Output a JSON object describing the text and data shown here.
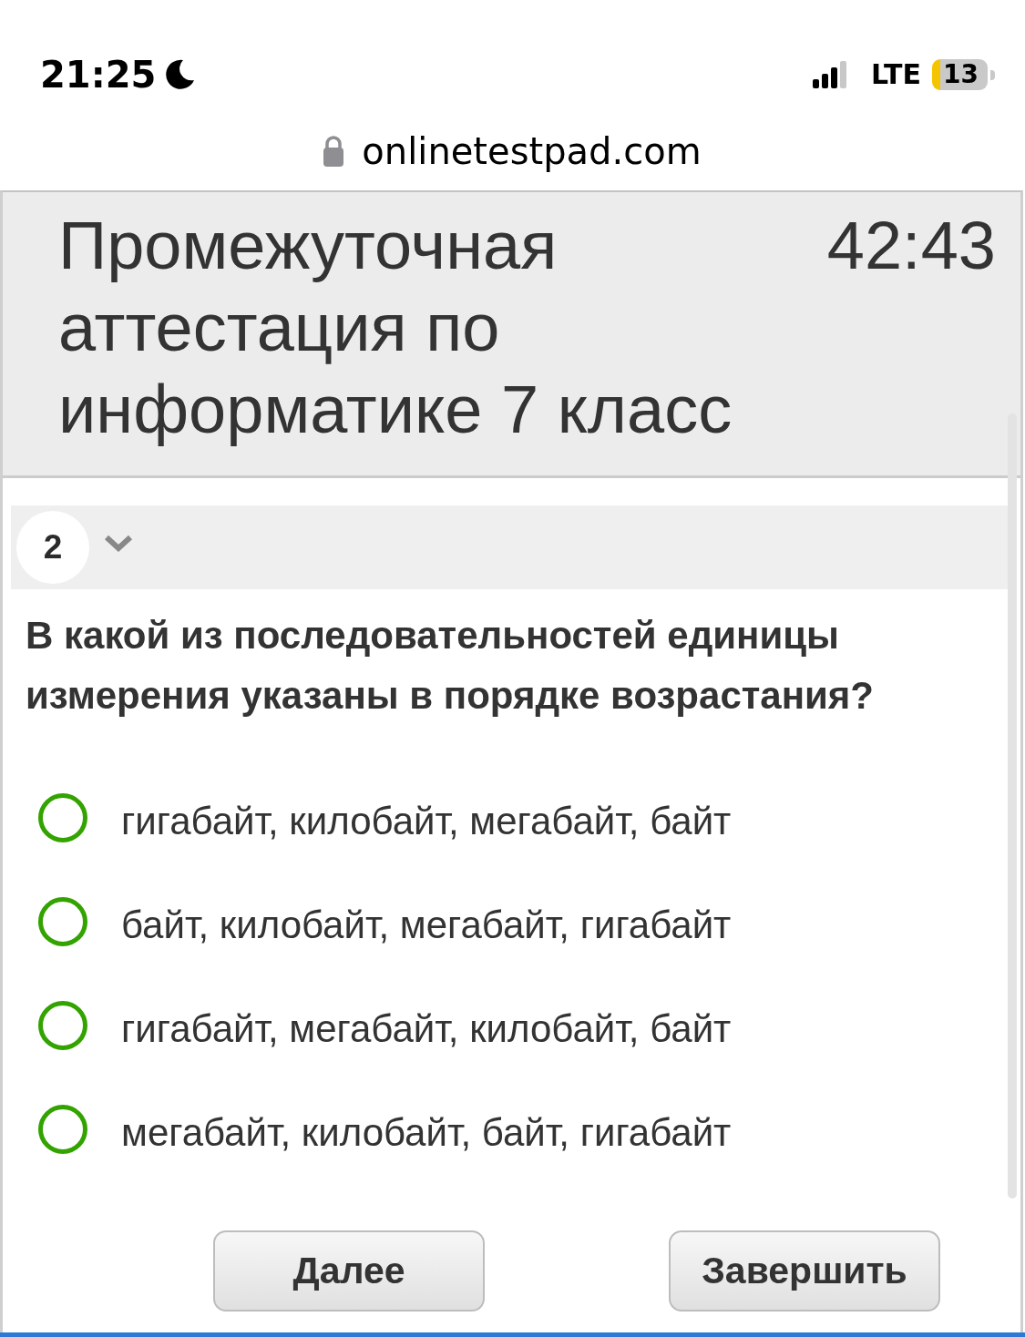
{
  "status_bar": {
    "time": "21:25",
    "network": "LTE",
    "battery": "13"
  },
  "address_bar": {
    "url": "onlinetestpad.com"
  },
  "test": {
    "title": "Промежуточная аттестация по информатике 7 класс",
    "timer": "42:43"
  },
  "question": {
    "number": "2",
    "text": "В какой из последовательностей единицы измерения указаны в порядке возрастания?",
    "options": [
      {
        "label": "гигабайт, килобайт, мегабайт, байт",
        "selected": false
      },
      {
        "label": "байт, килобайт, мегабайт, гигабайт",
        "selected": false
      },
      {
        "label": "гигабайт, мегабайт, килобайт, байт",
        "selected": false
      },
      {
        "label": "мегабайт, килобайт, байт, гигабайт",
        "selected": false
      }
    ]
  },
  "next_button": {
    "label": "Далее"
  },
  "finish_button": {
    "label": "Завершить"
  }
}
